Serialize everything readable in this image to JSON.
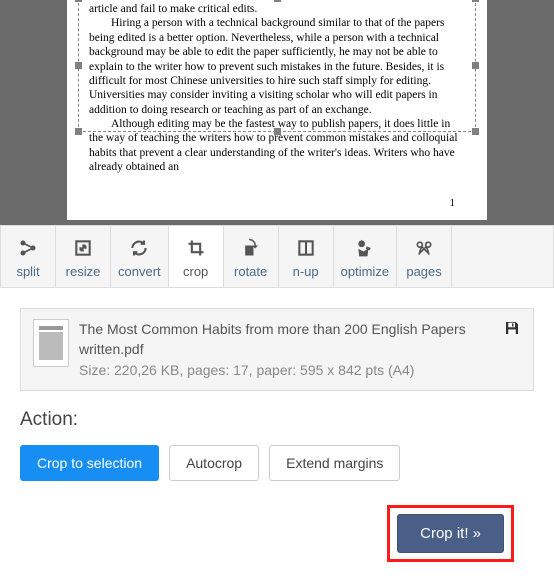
{
  "preview": {
    "text_line0": "article and fail to make critical edits.",
    "para1": "Hiring a person with a technical background similar to that of the papers being edited is a better option. Nevertheless, while a person with a technical background may be able to edit the paper sufficiently, he may not be able to explain to the writer how to prevent such mistakes in the future.  Besides, it is difficult for most Chinese universities to hire such staff simply for editing.  Universities may consider inviting a visiting scholar who will edit papers in addition to doing research or teaching as part of an exchange.",
    "para2": "Although editing may be the fastest way to publish papers, it does little in the way of teaching the writers how to prevent common mistakes and colloquial habits that prevent a clear understanding of the writer's ideas.  Writers who have already obtained an",
    "page_num": "1"
  },
  "toolbar": [
    {
      "label": "split"
    },
    {
      "label": "resize"
    },
    {
      "label": "convert"
    },
    {
      "label": "crop"
    },
    {
      "label": "rotate"
    },
    {
      "label": "n-up"
    },
    {
      "label": "optimize"
    },
    {
      "label": "pages"
    }
  ],
  "file": {
    "name": "The Most Common Habits from more than 200 English Papers written.pdf",
    "meta": "Size: 220,26 KB, pages: 17, paper: 595 x 842 pts (A4)"
  },
  "action": {
    "label": "Action:",
    "crop_selection": "Crop to selection",
    "autocrop": "Autocrop",
    "extend": "Extend margins",
    "crop_it": "Crop it! »"
  }
}
